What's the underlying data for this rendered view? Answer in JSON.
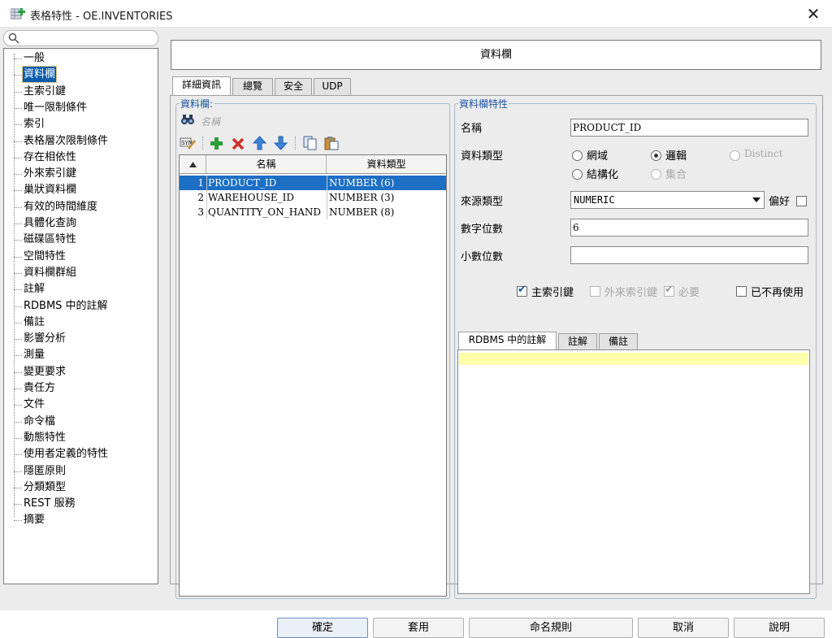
{
  "window": {
    "title": "表格特性 - OE.INVENTORIES",
    "close": "✕"
  },
  "nav": {
    "search_placeholder": "",
    "items": [
      "一般",
      "資料欄",
      "主索引鍵",
      "唯一限制條件",
      "索引",
      "表格層次限制條件",
      "存在相依性",
      "外來索引鍵",
      "巢狀資料欄",
      "有效的時間維度",
      "具體化查詢",
      "磁碟區特性",
      "空間特性",
      "資料欄群組",
      "註解",
      "RDBMS 中的註解",
      "備註",
      "影響分析",
      "測量",
      "變更要求",
      "責任方",
      "文件",
      "命令檔",
      "動態特性",
      "使用者定義的特性",
      "隱匿原則",
      "分類類型",
      "REST 服務",
      "摘要"
    ],
    "selected_index": 1
  },
  "header": {
    "title": "資料欄"
  },
  "tabs": [
    "詳細資訊",
    "總覽",
    "安全",
    "UDP"
  ],
  "columns_group": {
    "title": "資料欄:",
    "find_label": "名稱",
    "table": {
      "headers": [
        "名稱",
        "資料類型"
      ],
      "rows": [
        {
          "num": "1",
          "name": "PRODUCT_ID",
          "type": "NUMBER (6)"
        },
        {
          "num": "2",
          "name": "WAREHOUSE_ID",
          "type": "NUMBER (3)"
        },
        {
          "num": "3",
          "name": "QUANTITY_ON_HAND",
          "type": "NUMBER (8)"
        }
      ],
      "selected_row": 0
    }
  },
  "props": {
    "title": "資料欄特性",
    "name_label": "名稱",
    "name_value": "PRODUCT_ID",
    "datatype_label": "資料類型",
    "datatype_options": {
      "domain": "網域",
      "logical": "邏輯",
      "distinct": "Distinct",
      "structured": "結構化",
      "collection": "集合"
    },
    "datatype_selected": "邏輯",
    "source_type_label": "來源類型",
    "source_type_value": "NUMERIC",
    "preference_label": "偏好",
    "precision_label": "數字位數",
    "precision_value": "6",
    "scale_label": "小數位數",
    "scale_value": "",
    "pk_label": "主索引鍵",
    "pk_checked": true,
    "fk_label": "外來索引鍵",
    "fk_checked": false,
    "mandatory_label": "必要",
    "mandatory_checked": true,
    "deprecated_label": "已不再使用",
    "deprecated_checked": false,
    "sub_tabs": [
      "RDBMS 中的註解",
      "註解",
      "備註"
    ]
  },
  "buttons": {
    "ok": "確定",
    "apply": "套用",
    "naming_rules": "命名規則",
    "cancel": "取消",
    "help": "說明"
  },
  "colors": {
    "selection": "#0b5cad",
    "group_title": "#1d55a6",
    "highlight_row": "#ffffaa"
  }
}
